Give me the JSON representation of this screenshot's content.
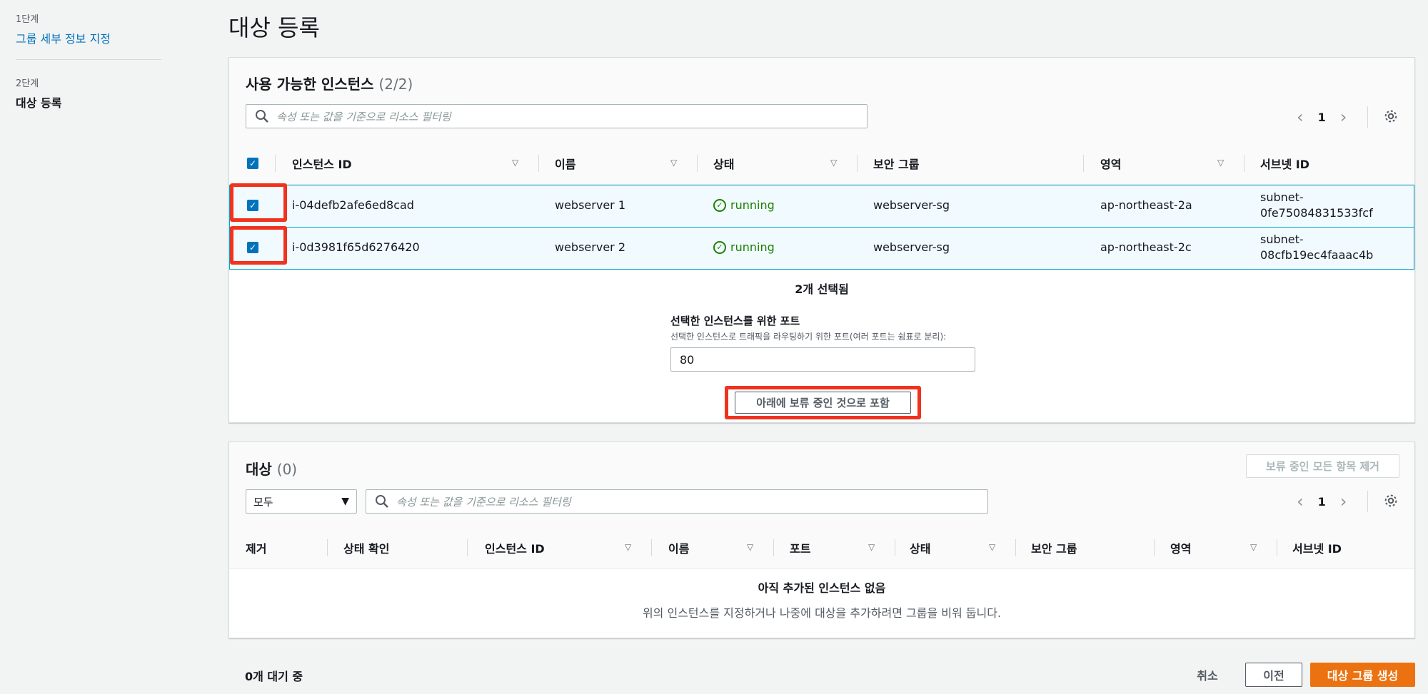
{
  "steps": [
    {
      "num": "1단계",
      "label": "그룹 세부 정보 지정"
    },
    {
      "num": "2단계",
      "label": "대상 등록"
    }
  ],
  "page_title": "대상 등록",
  "available": {
    "title": "사용 가능한 인스턴스",
    "count": "(2/2)",
    "search_placeholder": "속성 또는 값을 기준으로 리소스 필터링",
    "page": "1",
    "columns": [
      "인스턴스 ID",
      "이름",
      "상태",
      "보안 그룹",
      "영역",
      "서브넷 ID"
    ],
    "rows": [
      {
        "id": "i-04defb2afe6ed8cad",
        "name": "webserver 1",
        "status": "running",
        "sg": "webserver-sg",
        "az": "ap-northeast-2a",
        "subnet1": "subnet-",
        "subnet2": "0fe75084831533fcf"
      },
      {
        "id": "i-0d3981f65d6276420",
        "name": "webserver 2",
        "status": "running",
        "sg": "webserver-sg",
        "az": "ap-northeast-2c",
        "subnet1": "subnet-",
        "subnet2": "08cfb19ec4faaac4b"
      }
    ],
    "selected_text": "2개 선택됨",
    "port_label": "선택한 인스턴스를 위한 포트",
    "port_desc": "선택한 인스턴스로 트래픽을 라우팅하기 위한 포트(여러 포트는 쉼표로 분리):",
    "port_value": "80",
    "include_button": "아래에 보류 중인 것으로 포함"
  },
  "targets": {
    "title": "대상",
    "count": "(0)",
    "remove_all_button": "보류 중인 모든 항목 제거",
    "filter_select": "모두",
    "search_placeholder": "속성 또는 값을 기준으로 리소스 필터링",
    "page": "1",
    "columns": [
      "제거",
      "상태 확인",
      "인스턴스 ID",
      "이름",
      "포트",
      "상태",
      "보안 그룹",
      "영역",
      "서브넷 ID"
    ],
    "empty_title": "아직 추가된 인스턴스 없음",
    "empty_desc": "위의 인스턴스를 지정하거나 나중에 대상을 추가하려면 그룹을 비워 둡니다."
  },
  "footer": {
    "pending": "0개 대기 중",
    "cancel": "취소",
    "previous": "이전",
    "create": "대상 그룹 생성"
  },
  "colors": {
    "accent": "#0073bb",
    "primary_button": "#ec7211",
    "highlight": "#f0321e",
    "running": "#1d8102"
  }
}
